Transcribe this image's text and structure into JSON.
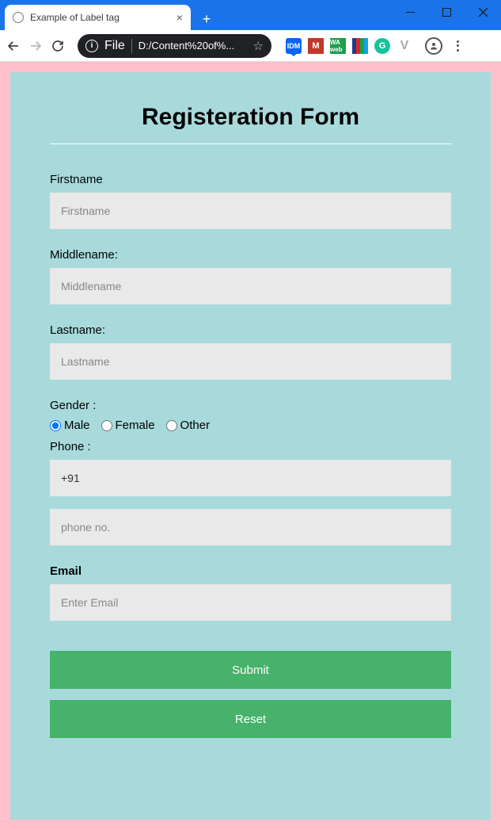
{
  "browser": {
    "tab_title": "Example of Label tag",
    "url_prefix": "File",
    "url_path": "D:/Content%20of%...",
    "extensions": {
      "gmail": "M",
      "green_label": "WA web"
    }
  },
  "page": {
    "title": "Registeration Form",
    "firstname": {
      "label": "Firstname",
      "placeholder": "Firstname"
    },
    "middlename": {
      "label": "Middlename:",
      "placeholder": "Middlename"
    },
    "lastname": {
      "label": "Lastname:",
      "placeholder": "Lastname"
    },
    "gender": {
      "label": "Gender :",
      "options": {
        "male": "Male",
        "female": "Female",
        "other": "Other"
      },
      "selected": "male"
    },
    "phone": {
      "label": "Phone :",
      "prefix_value": "+91",
      "number_placeholder": "phone no."
    },
    "email": {
      "label": "Email",
      "placeholder": "Enter Email"
    },
    "buttons": {
      "submit": "Submit",
      "reset": "Reset"
    }
  }
}
